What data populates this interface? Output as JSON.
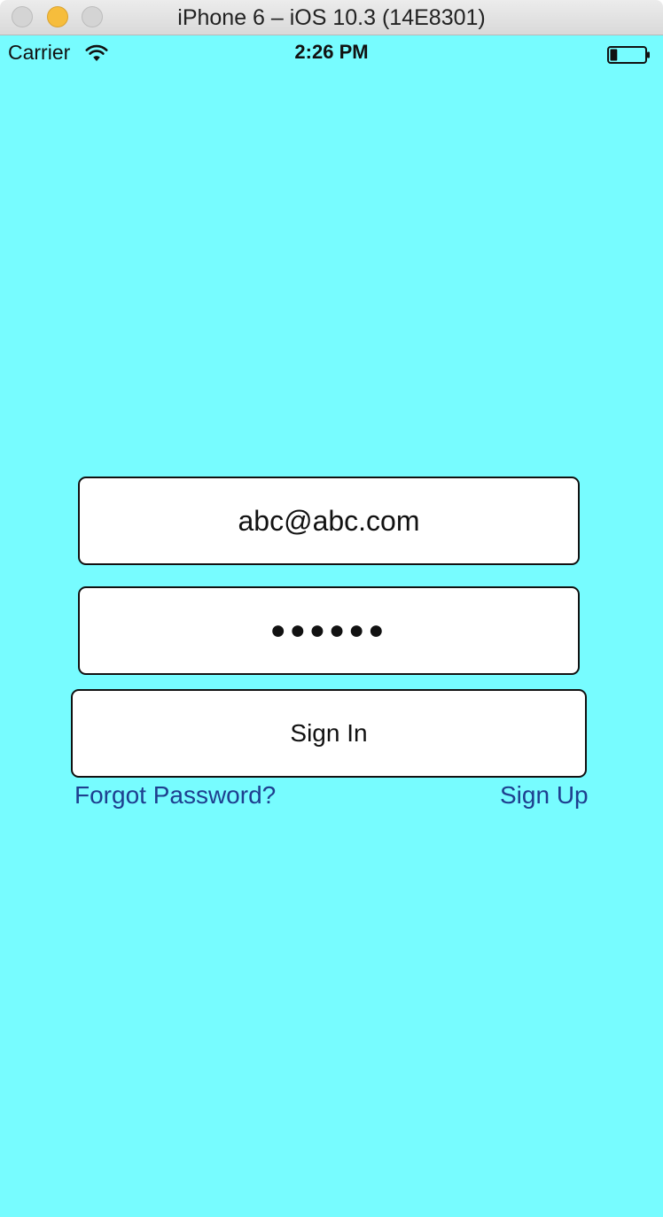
{
  "window": {
    "title": "iPhone 6 – iOS 10.3 (14E8301)"
  },
  "status_bar": {
    "carrier": "Carrier",
    "time": "2:26 PM",
    "wifi_icon": "wifi-icon",
    "battery_icon": "battery-icon",
    "battery_level": 0.2
  },
  "login": {
    "email_value": "abc@abc.com",
    "password_value": "●●●●●●",
    "signin_label": "Sign In",
    "forgot_password_label": "Forgot Password?",
    "signup_label": "Sign Up"
  },
  "colors": {
    "screen_background": "#77fcff",
    "link": "#1e3f8f",
    "field_background": "#ffffff"
  }
}
